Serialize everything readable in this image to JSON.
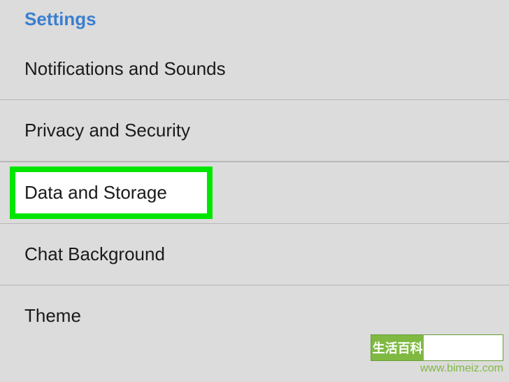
{
  "section": {
    "title": "Settings"
  },
  "items": [
    {
      "label": "Notifications and Sounds"
    },
    {
      "label": "Privacy and Security"
    },
    {
      "label": "Data and Storage",
      "highlighted": true
    },
    {
      "label": "Chat Background"
    },
    {
      "label": "Theme"
    }
  ],
  "watermark": {
    "chinese": "生活百科",
    "url": "www.bimeiz.com"
  }
}
